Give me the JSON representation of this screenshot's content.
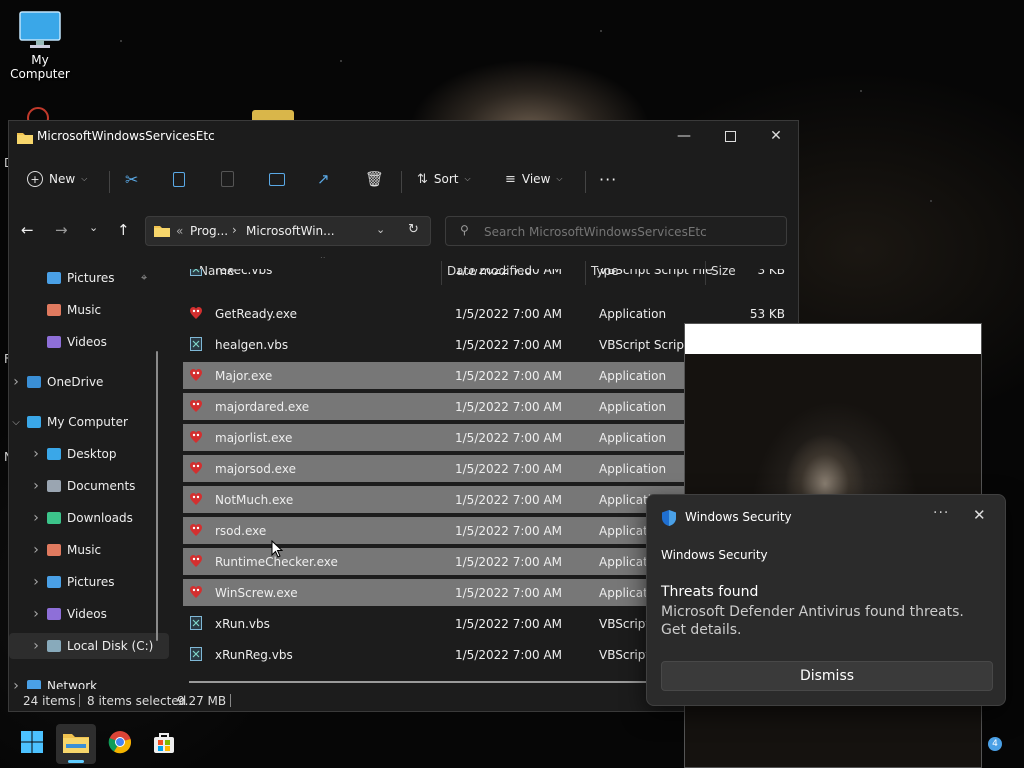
{
  "desktop": {
    "icons": [
      {
        "label": "My Computer"
      }
    ],
    "partial_letters": [
      "D",
      "F",
      "N"
    ]
  },
  "window": {
    "title": "MicrosoftWindowsServicesEtc",
    "toolbar": {
      "new_label": "New",
      "sort_label": "Sort",
      "view_label": "View"
    },
    "address": {
      "segment_1": "Prog...",
      "segment_2": "MicrosoftWin...",
      "prefix": "«"
    },
    "search": {
      "placeholder": "Search MicrosoftWindowsServicesEtc"
    },
    "nav": {
      "items": [
        {
          "label": "Pictures",
          "icon": "pictures-icon"
        },
        {
          "label": "Music",
          "icon": "music-icon"
        },
        {
          "label": "Videos",
          "icon": "videos-icon"
        },
        {
          "label": "OneDrive",
          "icon": "cloud-icon"
        },
        {
          "label": "My Computer",
          "icon": "computer-icon"
        },
        {
          "label": "Desktop",
          "icon": "desktop-icon"
        },
        {
          "label": "Documents",
          "icon": "documents-icon"
        },
        {
          "label": "Downloads",
          "icon": "download-icon"
        },
        {
          "label": "Music",
          "icon": "music-icon"
        },
        {
          "label": "Pictures",
          "icon": "pictures-icon"
        },
        {
          "label": "Videos",
          "icon": "videos-icon"
        },
        {
          "label": "Local Disk (C:)",
          "icon": "drive-icon"
        },
        {
          "label": "Network",
          "icon": "network-icon"
        }
      ]
    },
    "columns": {
      "name": "Name",
      "date": "Date modified",
      "type": "Type",
      "size": "Size"
    },
    "files": [
      {
        "name": "rexec.vbs",
        "date": "1/5/2022 7:00 AM",
        "type": "VBScript Script File",
        "size": "3 KB",
        "icon": "script-icon",
        "selected": false
      },
      {
        "name": "GetReady.exe",
        "date": "1/5/2022 7:00 AM",
        "type": "Application",
        "size": "53 KB",
        "icon": "app-icon",
        "selected": false
      },
      {
        "name": "healgen.vbs",
        "date": "1/5/2022 7:00 AM",
        "type": "VBScript Script File",
        "size": "",
        "icon": "script-icon",
        "selected": false
      },
      {
        "name": "Major.exe",
        "date": "1/5/2022 7:00 AM",
        "type": "Application",
        "size": "",
        "icon": "app-icon",
        "selected": true
      },
      {
        "name": "majordared.exe",
        "date": "1/5/2022 7:00 AM",
        "type": "Application",
        "size": "",
        "icon": "app-icon",
        "selected": true
      },
      {
        "name": "majorlist.exe",
        "date": "1/5/2022 7:00 AM",
        "type": "Application",
        "size": "",
        "icon": "app-icon",
        "selected": true
      },
      {
        "name": "majorsod.exe",
        "date": "1/5/2022 7:00 AM",
        "type": "Application",
        "size": "",
        "icon": "app-icon",
        "selected": true
      },
      {
        "name": "NotMuch.exe",
        "date": "1/5/2022 7:00 AM",
        "type": "Applicatio",
        "size": "",
        "icon": "app-icon",
        "selected": true
      },
      {
        "name": "rsod.exe",
        "date": "1/5/2022 7:00 AM",
        "type": "Applicatio",
        "size": "",
        "icon": "app-icon",
        "selected": true
      },
      {
        "name": "RuntimeChecker.exe",
        "date": "1/5/2022 7:00 AM",
        "type": "Applicatio",
        "size": "",
        "icon": "app-icon",
        "selected": true
      },
      {
        "name": "WinScrew.exe",
        "date": "1/5/2022 7:00 AM",
        "type": "Applicatio",
        "size": "",
        "icon": "app-icon",
        "selected": true
      },
      {
        "name": "xRun.vbs",
        "date": "1/5/2022 7:00 AM",
        "type": "VBScript Sc",
        "size": "",
        "icon": "script-icon",
        "selected": false
      },
      {
        "name": "xRunReg.vbs",
        "date": "1/5/2022 7:00 AM",
        "type": "VBScript Sc",
        "size": "",
        "icon": "script-icon",
        "selected": false
      }
    ],
    "status": {
      "items": "24 items",
      "selected": "8 items selected",
      "size": "9.27 MB"
    }
  },
  "toast": {
    "app_name": "Windows Security",
    "subtitle": "Windows Security",
    "heading": "Threats found",
    "body": "Microsoft Defender Antivirus found threats. Get details.",
    "dismiss_label": "Dismiss",
    "more_label": "···"
  },
  "taskbar": {
    "apps": [
      "start-icon",
      "file-explorer-icon",
      "chrome-icon",
      "store-icon"
    ],
    "badge": "4"
  },
  "colors": {
    "selection": "#777777",
    "window_bg": "#1c1c1c",
    "accent": "#4aa0e6",
    "toast_bg": "#2b2b2b"
  }
}
